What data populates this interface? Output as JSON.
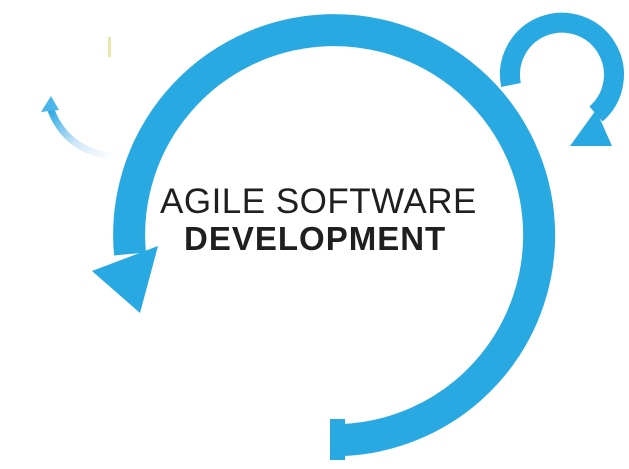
{
  "title": {
    "line1": "AGILE SOFTWARE",
    "line2": "DEVELOPMENT"
  },
  "colors": {
    "cycle_blue": "#29a9e2",
    "fade_blue_light": "#dceefb",
    "text_dark": "#1f1f1f",
    "accent_yellow": "#e9e7a8"
  },
  "icons": {
    "main_cycle": "circular-arrow-icon",
    "small_loop": "loop-arrow-icon",
    "faded_arrow": "faded-arrow-icon"
  }
}
